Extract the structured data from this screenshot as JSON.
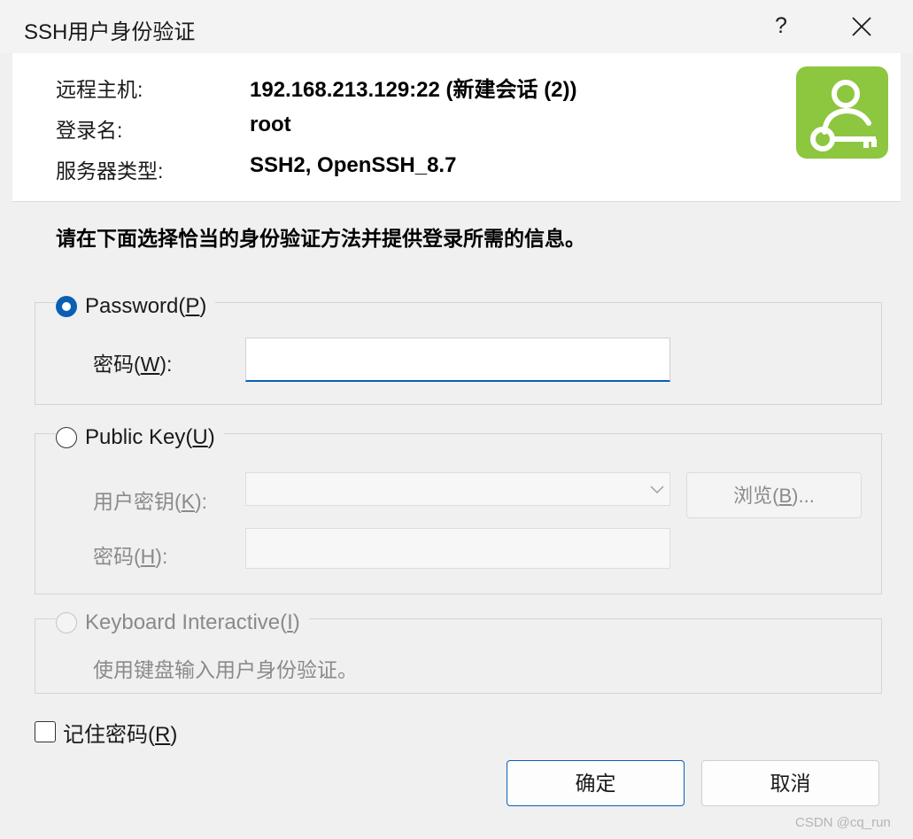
{
  "window": {
    "title": "SSH用户身份验证",
    "help_label": "?"
  },
  "header": {
    "remote_host_label": "远程主机:",
    "remote_host_value": "192.168.213.129:22 (新建会话 (2))",
    "login_label": "登录名:",
    "login_value": "root",
    "server_type_label": "服务器类型:",
    "server_type_value": "SSH2, OpenSSH_8.7",
    "logo_icon": "user-key-icon",
    "logo_color": "#8dc63f"
  },
  "instruction": "请在下面选择恰当的身份验证方法并提供登录所需的信息。",
  "methods": {
    "password": {
      "label_prefix": "Password(",
      "mnemonic": "P",
      "label_suffix": ")",
      "selected": true,
      "field_label_prefix": "密码(",
      "field_mnemonic": "W",
      "field_label_suffix": "):",
      "field_value": ""
    },
    "public_key": {
      "label_prefix": "Public Key(",
      "mnemonic": "U",
      "label_suffix": ")",
      "selected": false,
      "user_key_label_prefix": "用户密钥(",
      "user_key_mnemonic": "K",
      "user_key_label_suffix": "):",
      "user_key_value": "",
      "browse_prefix": "浏览(",
      "browse_mnemonic": "B",
      "browse_suffix": ")...",
      "passphrase_label_prefix": "密码(",
      "passphrase_mnemonic": "H",
      "passphrase_label_suffix": "):",
      "passphrase_value": ""
    },
    "keyboard_interactive": {
      "label_prefix": "Keyboard Interactive(",
      "mnemonic": "I",
      "label_suffix": ")",
      "selected": false,
      "description": "使用键盘输入用户身份验证。"
    }
  },
  "remember_password": {
    "label_prefix": "记住密码(",
    "mnemonic": "R",
    "label_suffix": ")",
    "checked": false
  },
  "buttons": {
    "ok": "确定",
    "cancel": "取消"
  },
  "watermark": "CSDN @cq_run",
  "colors": {
    "accent": "#0a5fb4",
    "disabled_text": "#8a8a8a"
  }
}
